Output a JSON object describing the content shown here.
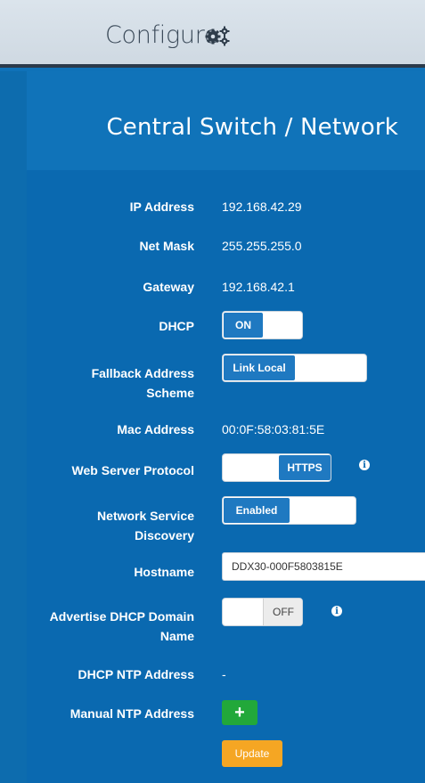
{
  "header": {
    "title": "Configure"
  },
  "section": {
    "title": "Central Switch / Network"
  },
  "fields": {
    "ip_address": {
      "label": "IP Address",
      "value": "192.168.42.29"
    },
    "net_mask": {
      "label": "Net Mask",
      "value": "255.255.255.0"
    },
    "gateway": {
      "label": "Gateway",
      "value": "192.168.42.1"
    },
    "dhcp": {
      "label": "DHCP",
      "on_label": "ON",
      "state": "on"
    },
    "fallback": {
      "label_line1": "Fallback Address",
      "label_line2": "Scheme",
      "selected": "Link Local"
    },
    "mac_address": {
      "label": "Mac Address",
      "value": "00:0F:58:03:81:5E"
    },
    "web_protocol": {
      "label": "Web Server Protocol",
      "selected": "HTTPS"
    },
    "service_discovery": {
      "label_line1": "Network Service",
      "label_line2": "Discovery",
      "selected": "Enabled"
    },
    "hostname": {
      "label": "Hostname",
      "value": "DDX30-000F5803815E"
    },
    "advertise_dhcp": {
      "label_line1": "Advertise DHCP Domain",
      "label_line2": "Name",
      "off_label": "OFF",
      "state": "off"
    },
    "dhcp_ntp": {
      "label": "DHCP NTP Address",
      "value": "-"
    },
    "manual_ntp": {
      "label": "Manual NTP Address",
      "add_label": "+"
    }
  },
  "actions": {
    "update_label": "Update"
  },
  "colors": {
    "background": "#0f72b8",
    "panel": "#0a69b0",
    "toggle_on": "#1f79c1",
    "add": "#22a83a",
    "update": "#f5a623"
  },
  "icons": {
    "header": "gears-icon",
    "info": "info-icon"
  }
}
